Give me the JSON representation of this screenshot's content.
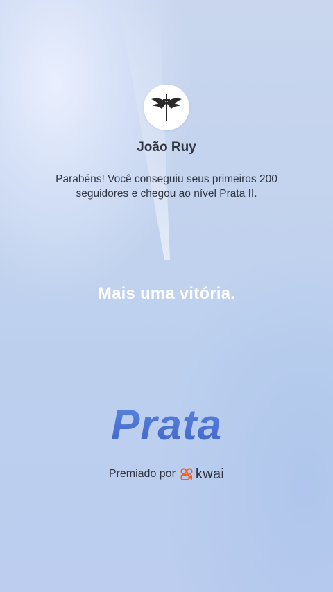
{
  "profile": {
    "avatar_icon": "winged-sword-icon",
    "name": "João Ruy"
  },
  "message": "Parabéns! Você conseguiu seus primeiros 200 seguidores e chegou ao nível Prata II.",
  "headline": "Mais uma vitória.",
  "level": "Prata",
  "award": {
    "label": "Premiado por",
    "brand_icon": "kwai-logo-icon",
    "brand_name": "kwai"
  },
  "colors": {
    "level_text": "#4a6fd0",
    "brand_accent": "#ff5a1f",
    "text_dark": "#2f3440",
    "headline": "#ffffff"
  }
}
